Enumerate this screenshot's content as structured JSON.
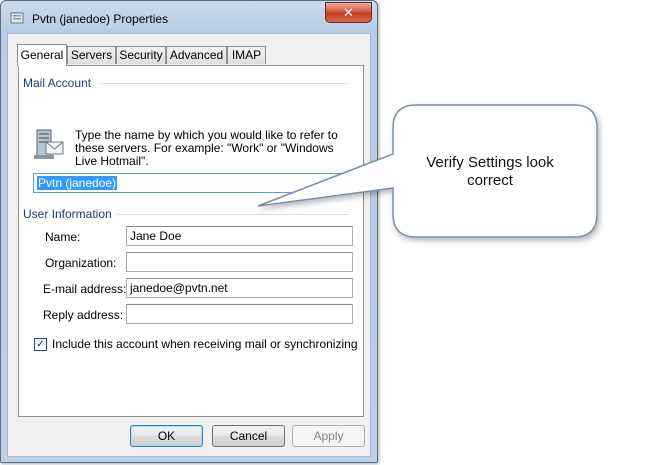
{
  "window": {
    "title": "Pvtn (janedoe) Properties",
    "close_label": "✕"
  },
  "tabs": [
    {
      "label": "General",
      "active": true
    },
    {
      "label": "Servers",
      "active": false
    },
    {
      "label": "Security",
      "active": false
    },
    {
      "label": "Advanced",
      "active": false
    },
    {
      "label": "IMAP",
      "active": false
    }
  ],
  "mail_account": {
    "group_label": "Mail Account",
    "description": "Type the name by which you would like to refer to these servers.  For example: \"Work\" or \"Windows Live Hotmail\".",
    "account_name": "Pvtn (janedoe)",
    "icon": "mail-server-icon"
  },
  "user_info": {
    "group_label": "User Information",
    "name_label": "Name:",
    "name_value": "Jane Doe",
    "organization_label": "Organization:",
    "organization_value": "",
    "email_label": "E-mail address:",
    "email_value": "janedoe@pvtn.net",
    "reply_label": "Reply address:",
    "reply_value": ""
  },
  "include_checkbox": {
    "label": "Include this account when receiving mail or synchronizing",
    "checked": true,
    "mark": "✓"
  },
  "buttons": {
    "ok": "OK",
    "cancel": "Cancel",
    "apply": "Apply"
  },
  "callout": {
    "text": "Verify Settings look correct"
  },
  "colors": {
    "accent": "#3399ff",
    "group_label": "#1e3a6e",
    "close_button": "#c23b22"
  }
}
